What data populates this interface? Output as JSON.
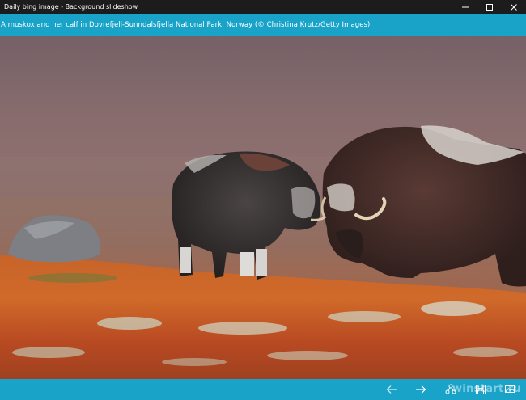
{
  "window": {
    "title": "Daily bing image - Background slideshow",
    "controls": [
      "minimize-icon",
      "maximize-icon",
      "close-icon"
    ]
  },
  "caption": {
    "text": "A muskox and her calf in Dovrefjell-Sunndalsfjella National Park, Norway (© Christina Krutz/Getty Images)"
  },
  "photo": {
    "subject": "muskox-image"
  },
  "toolbar": {
    "buttons": [
      "back-arrow-icon",
      "forward-arrow-icon",
      "share-icon",
      "save-icon",
      "set-wallpaper-icon"
    ],
    "watermark": "winstart.ru"
  },
  "colors": {
    "titlebar": "#1c1c1c",
    "accent": "#1aa3c9"
  }
}
